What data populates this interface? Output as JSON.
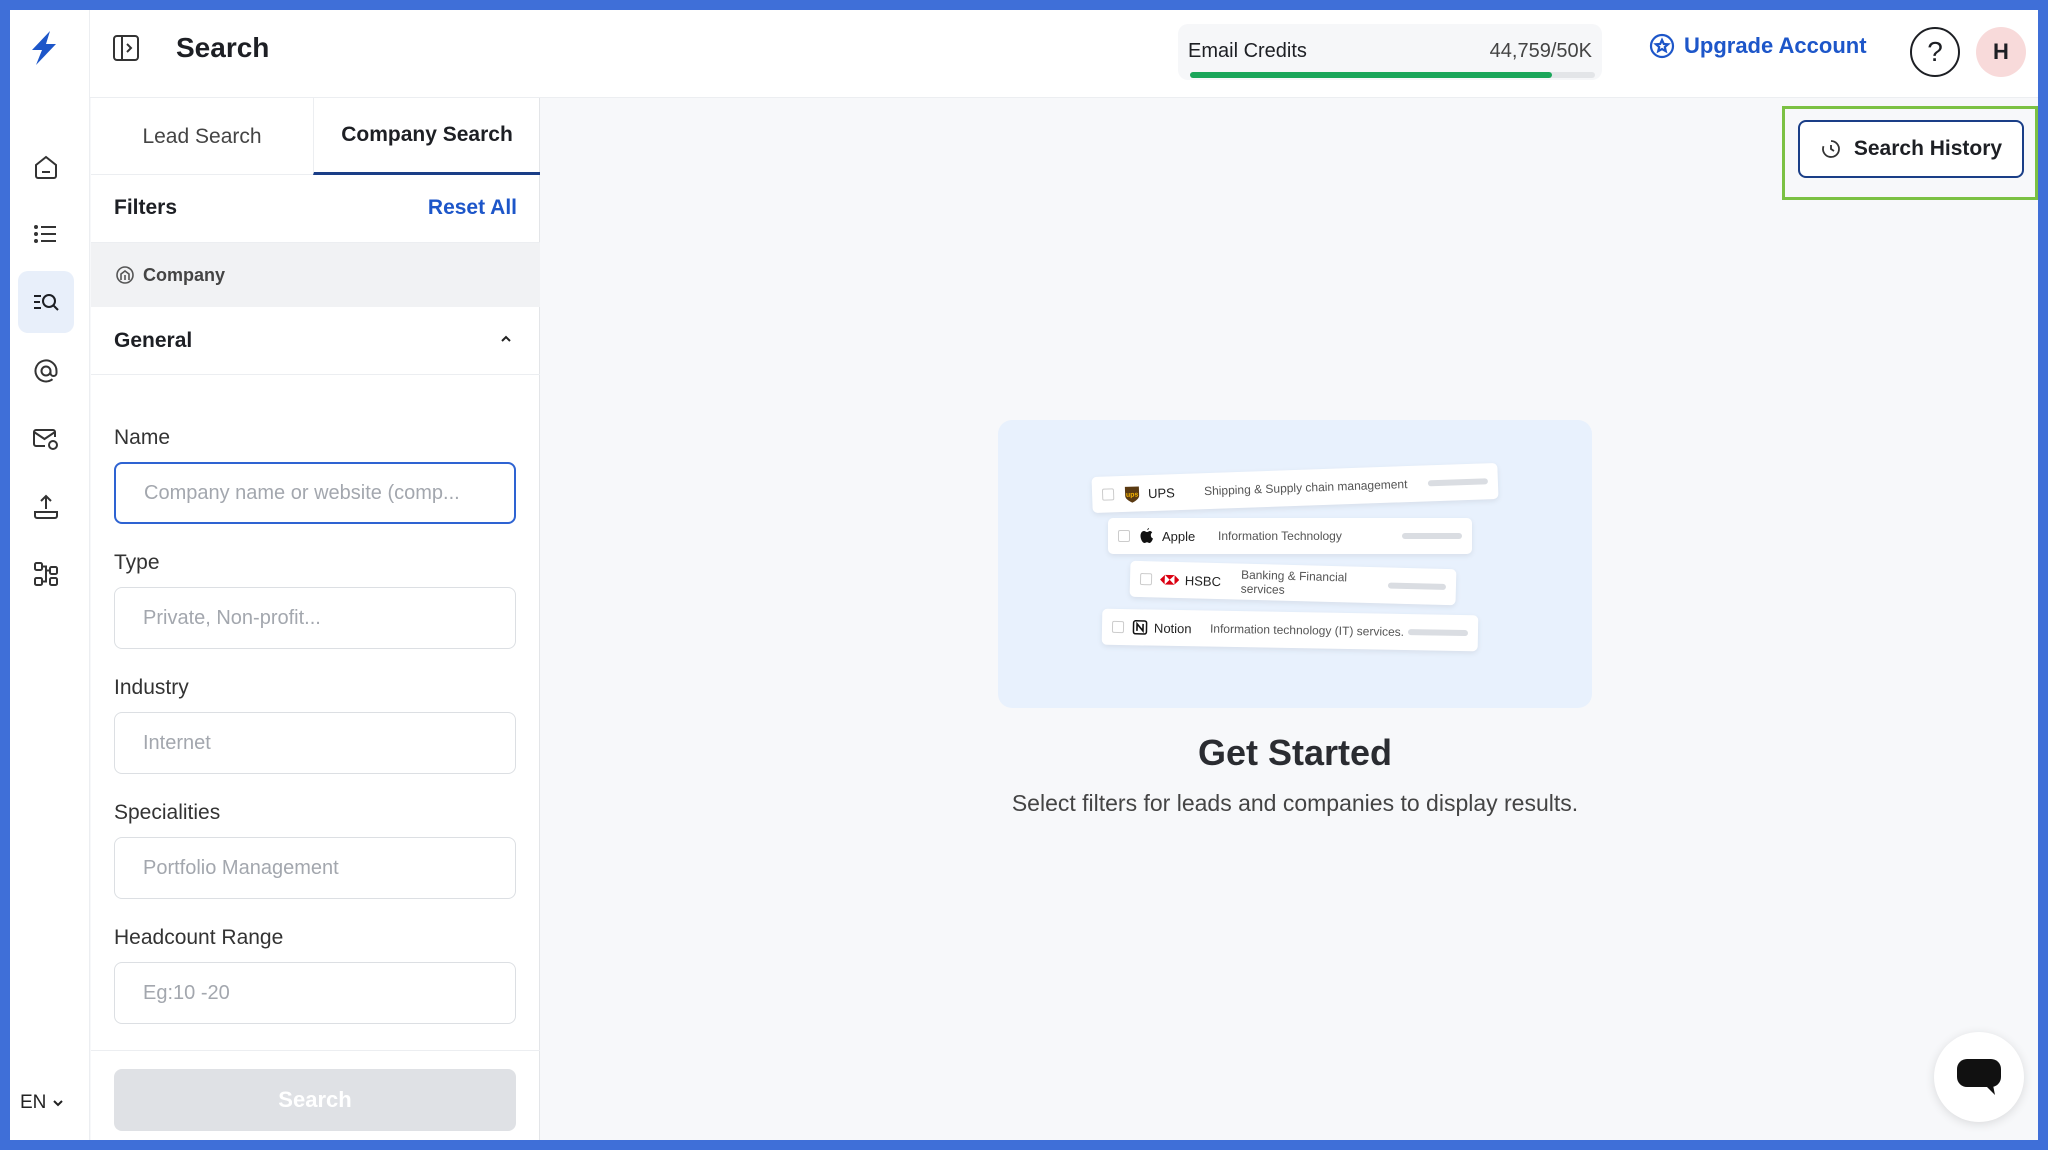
{
  "header": {
    "title": "Search",
    "credits_label": "Email Credits",
    "credits_value": "44,759/50K",
    "credits_fraction": 0.895,
    "upgrade_label": "Upgrade Account",
    "help_label": "?",
    "avatar_initial": "H"
  },
  "rail": {
    "items": [
      "home-icon",
      "list-icon",
      "search-list-icon",
      "at-sign-icon",
      "mail-settings-icon",
      "upload-icon",
      "workflow-icon"
    ],
    "active_index": 2,
    "language": "EN"
  },
  "panel": {
    "tabs": [
      {
        "label": "Lead Search"
      },
      {
        "label": "Company Search"
      }
    ],
    "filters_title": "Filters",
    "reset_label": "Reset All",
    "section_label": "Company",
    "group_label": "General",
    "fields": [
      {
        "label": "Name",
        "placeholder": "Company name or website (comp..."
      },
      {
        "label": "Type",
        "placeholder": "Private, Non-profit..."
      },
      {
        "label": "Industry",
        "placeholder": "Internet"
      },
      {
        "label": "Specialities",
        "placeholder": "Portfolio Management"
      },
      {
        "label": "Headcount Range",
        "placeholder": "Eg:10 -20"
      }
    ],
    "search_label": "Search"
  },
  "main": {
    "history_label": "Search History",
    "cards": [
      {
        "brand": "UPS",
        "sector": "Shipping & Supply chain management"
      },
      {
        "brand": "Apple",
        "sector": "Information Technology"
      },
      {
        "brand": "HSBC",
        "sector": "Banking & Financial services"
      },
      {
        "brand": "Notion",
        "sector": "Information technology (IT) services."
      }
    ],
    "title": "Get Started",
    "subtitle": "Select filters for leads and companies to display results."
  },
  "colors": {
    "accent": "#1d56c9",
    "active_tab": "#1a3e87",
    "progress": "#1aa65a",
    "highlight": "#7bc143"
  }
}
